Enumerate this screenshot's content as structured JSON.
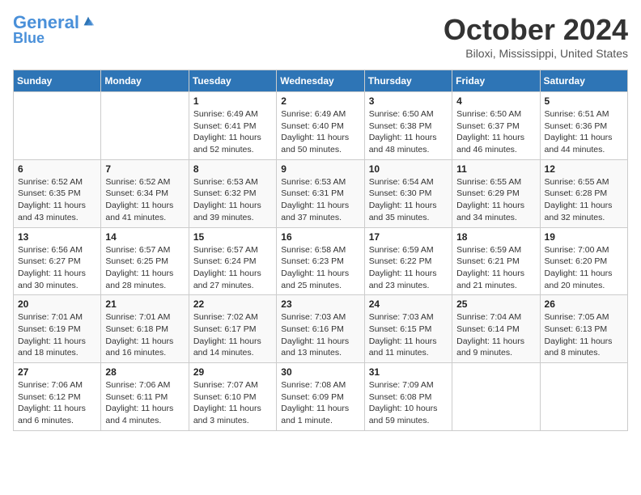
{
  "header": {
    "logo_line1": "General",
    "logo_line2": "Blue",
    "month_title": "October 2024",
    "location": "Biloxi, Mississippi, United States"
  },
  "weekdays": [
    "Sunday",
    "Monday",
    "Tuesday",
    "Wednesday",
    "Thursday",
    "Friday",
    "Saturday"
  ],
  "weeks": [
    [
      {
        "day": "",
        "info": ""
      },
      {
        "day": "",
        "info": ""
      },
      {
        "day": "1",
        "info": "Sunrise: 6:49 AM\nSunset: 6:41 PM\nDaylight: 11 hours\nand 52 minutes."
      },
      {
        "day": "2",
        "info": "Sunrise: 6:49 AM\nSunset: 6:40 PM\nDaylight: 11 hours\nand 50 minutes."
      },
      {
        "day": "3",
        "info": "Sunrise: 6:50 AM\nSunset: 6:38 PM\nDaylight: 11 hours\nand 48 minutes."
      },
      {
        "day": "4",
        "info": "Sunrise: 6:50 AM\nSunset: 6:37 PM\nDaylight: 11 hours\nand 46 minutes."
      },
      {
        "day": "5",
        "info": "Sunrise: 6:51 AM\nSunset: 6:36 PM\nDaylight: 11 hours\nand 44 minutes."
      }
    ],
    [
      {
        "day": "6",
        "info": "Sunrise: 6:52 AM\nSunset: 6:35 PM\nDaylight: 11 hours\nand 43 minutes."
      },
      {
        "day": "7",
        "info": "Sunrise: 6:52 AM\nSunset: 6:34 PM\nDaylight: 11 hours\nand 41 minutes."
      },
      {
        "day": "8",
        "info": "Sunrise: 6:53 AM\nSunset: 6:32 PM\nDaylight: 11 hours\nand 39 minutes."
      },
      {
        "day": "9",
        "info": "Sunrise: 6:53 AM\nSunset: 6:31 PM\nDaylight: 11 hours\nand 37 minutes."
      },
      {
        "day": "10",
        "info": "Sunrise: 6:54 AM\nSunset: 6:30 PM\nDaylight: 11 hours\nand 35 minutes."
      },
      {
        "day": "11",
        "info": "Sunrise: 6:55 AM\nSunset: 6:29 PM\nDaylight: 11 hours\nand 34 minutes."
      },
      {
        "day": "12",
        "info": "Sunrise: 6:55 AM\nSunset: 6:28 PM\nDaylight: 11 hours\nand 32 minutes."
      }
    ],
    [
      {
        "day": "13",
        "info": "Sunrise: 6:56 AM\nSunset: 6:27 PM\nDaylight: 11 hours\nand 30 minutes."
      },
      {
        "day": "14",
        "info": "Sunrise: 6:57 AM\nSunset: 6:25 PM\nDaylight: 11 hours\nand 28 minutes."
      },
      {
        "day": "15",
        "info": "Sunrise: 6:57 AM\nSunset: 6:24 PM\nDaylight: 11 hours\nand 27 minutes."
      },
      {
        "day": "16",
        "info": "Sunrise: 6:58 AM\nSunset: 6:23 PM\nDaylight: 11 hours\nand 25 minutes."
      },
      {
        "day": "17",
        "info": "Sunrise: 6:59 AM\nSunset: 6:22 PM\nDaylight: 11 hours\nand 23 minutes."
      },
      {
        "day": "18",
        "info": "Sunrise: 6:59 AM\nSunset: 6:21 PM\nDaylight: 11 hours\nand 21 minutes."
      },
      {
        "day": "19",
        "info": "Sunrise: 7:00 AM\nSunset: 6:20 PM\nDaylight: 11 hours\nand 20 minutes."
      }
    ],
    [
      {
        "day": "20",
        "info": "Sunrise: 7:01 AM\nSunset: 6:19 PM\nDaylight: 11 hours\nand 18 minutes."
      },
      {
        "day": "21",
        "info": "Sunrise: 7:01 AM\nSunset: 6:18 PM\nDaylight: 11 hours\nand 16 minutes."
      },
      {
        "day": "22",
        "info": "Sunrise: 7:02 AM\nSunset: 6:17 PM\nDaylight: 11 hours\nand 14 minutes."
      },
      {
        "day": "23",
        "info": "Sunrise: 7:03 AM\nSunset: 6:16 PM\nDaylight: 11 hours\nand 13 minutes."
      },
      {
        "day": "24",
        "info": "Sunrise: 7:03 AM\nSunset: 6:15 PM\nDaylight: 11 hours\nand 11 minutes."
      },
      {
        "day": "25",
        "info": "Sunrise: 7:04 AM\nSunset: 6:14 PM\nDaylight: 11 hours\nand 9 minutes."
      },
      {
        "day": "26",
        "info": "Sunrise: 7:05 AM\nSunset: 6:13 PM\nDaylight: 11 hours\nand 8 minutes."
      }
    ],
    [
      {
        "day": "27",
        "info": "Sunrise: 7:06 AM\nSunset: 6:12 PM\nDaylight: 11 hours\nand 6 minutes."
      },
      {
        "day": "28",
        "info": "Sunrise: 7:06 AM\nSunset: 6:11 PM\nDaylight: 11 hours\nand 4 minutes."
      },
      {
        "day": "29",
        "info": "Sunrise: 7:07 AM\nSunset: 6:10 PM\nDaylight: 11 hours\nand 3 minutes."
      },
      {
        "day": "30",
        "info": "Sunrise: 7:08 AM\nSunset: 6:09 PM\nDaylight: 11 hours\nand 1 minute."
      },
      {
        "day": "31",
        "info": "Sunrise: 7:09 AM\nSunset: 6:08 PM\nDaylight: 10 hours\nand 59 minutes."
      },
      {
        "day": "",
        "info": ""
      },
      {
        "day": "",
        "info": ""
      }
    ]
  ]
}
